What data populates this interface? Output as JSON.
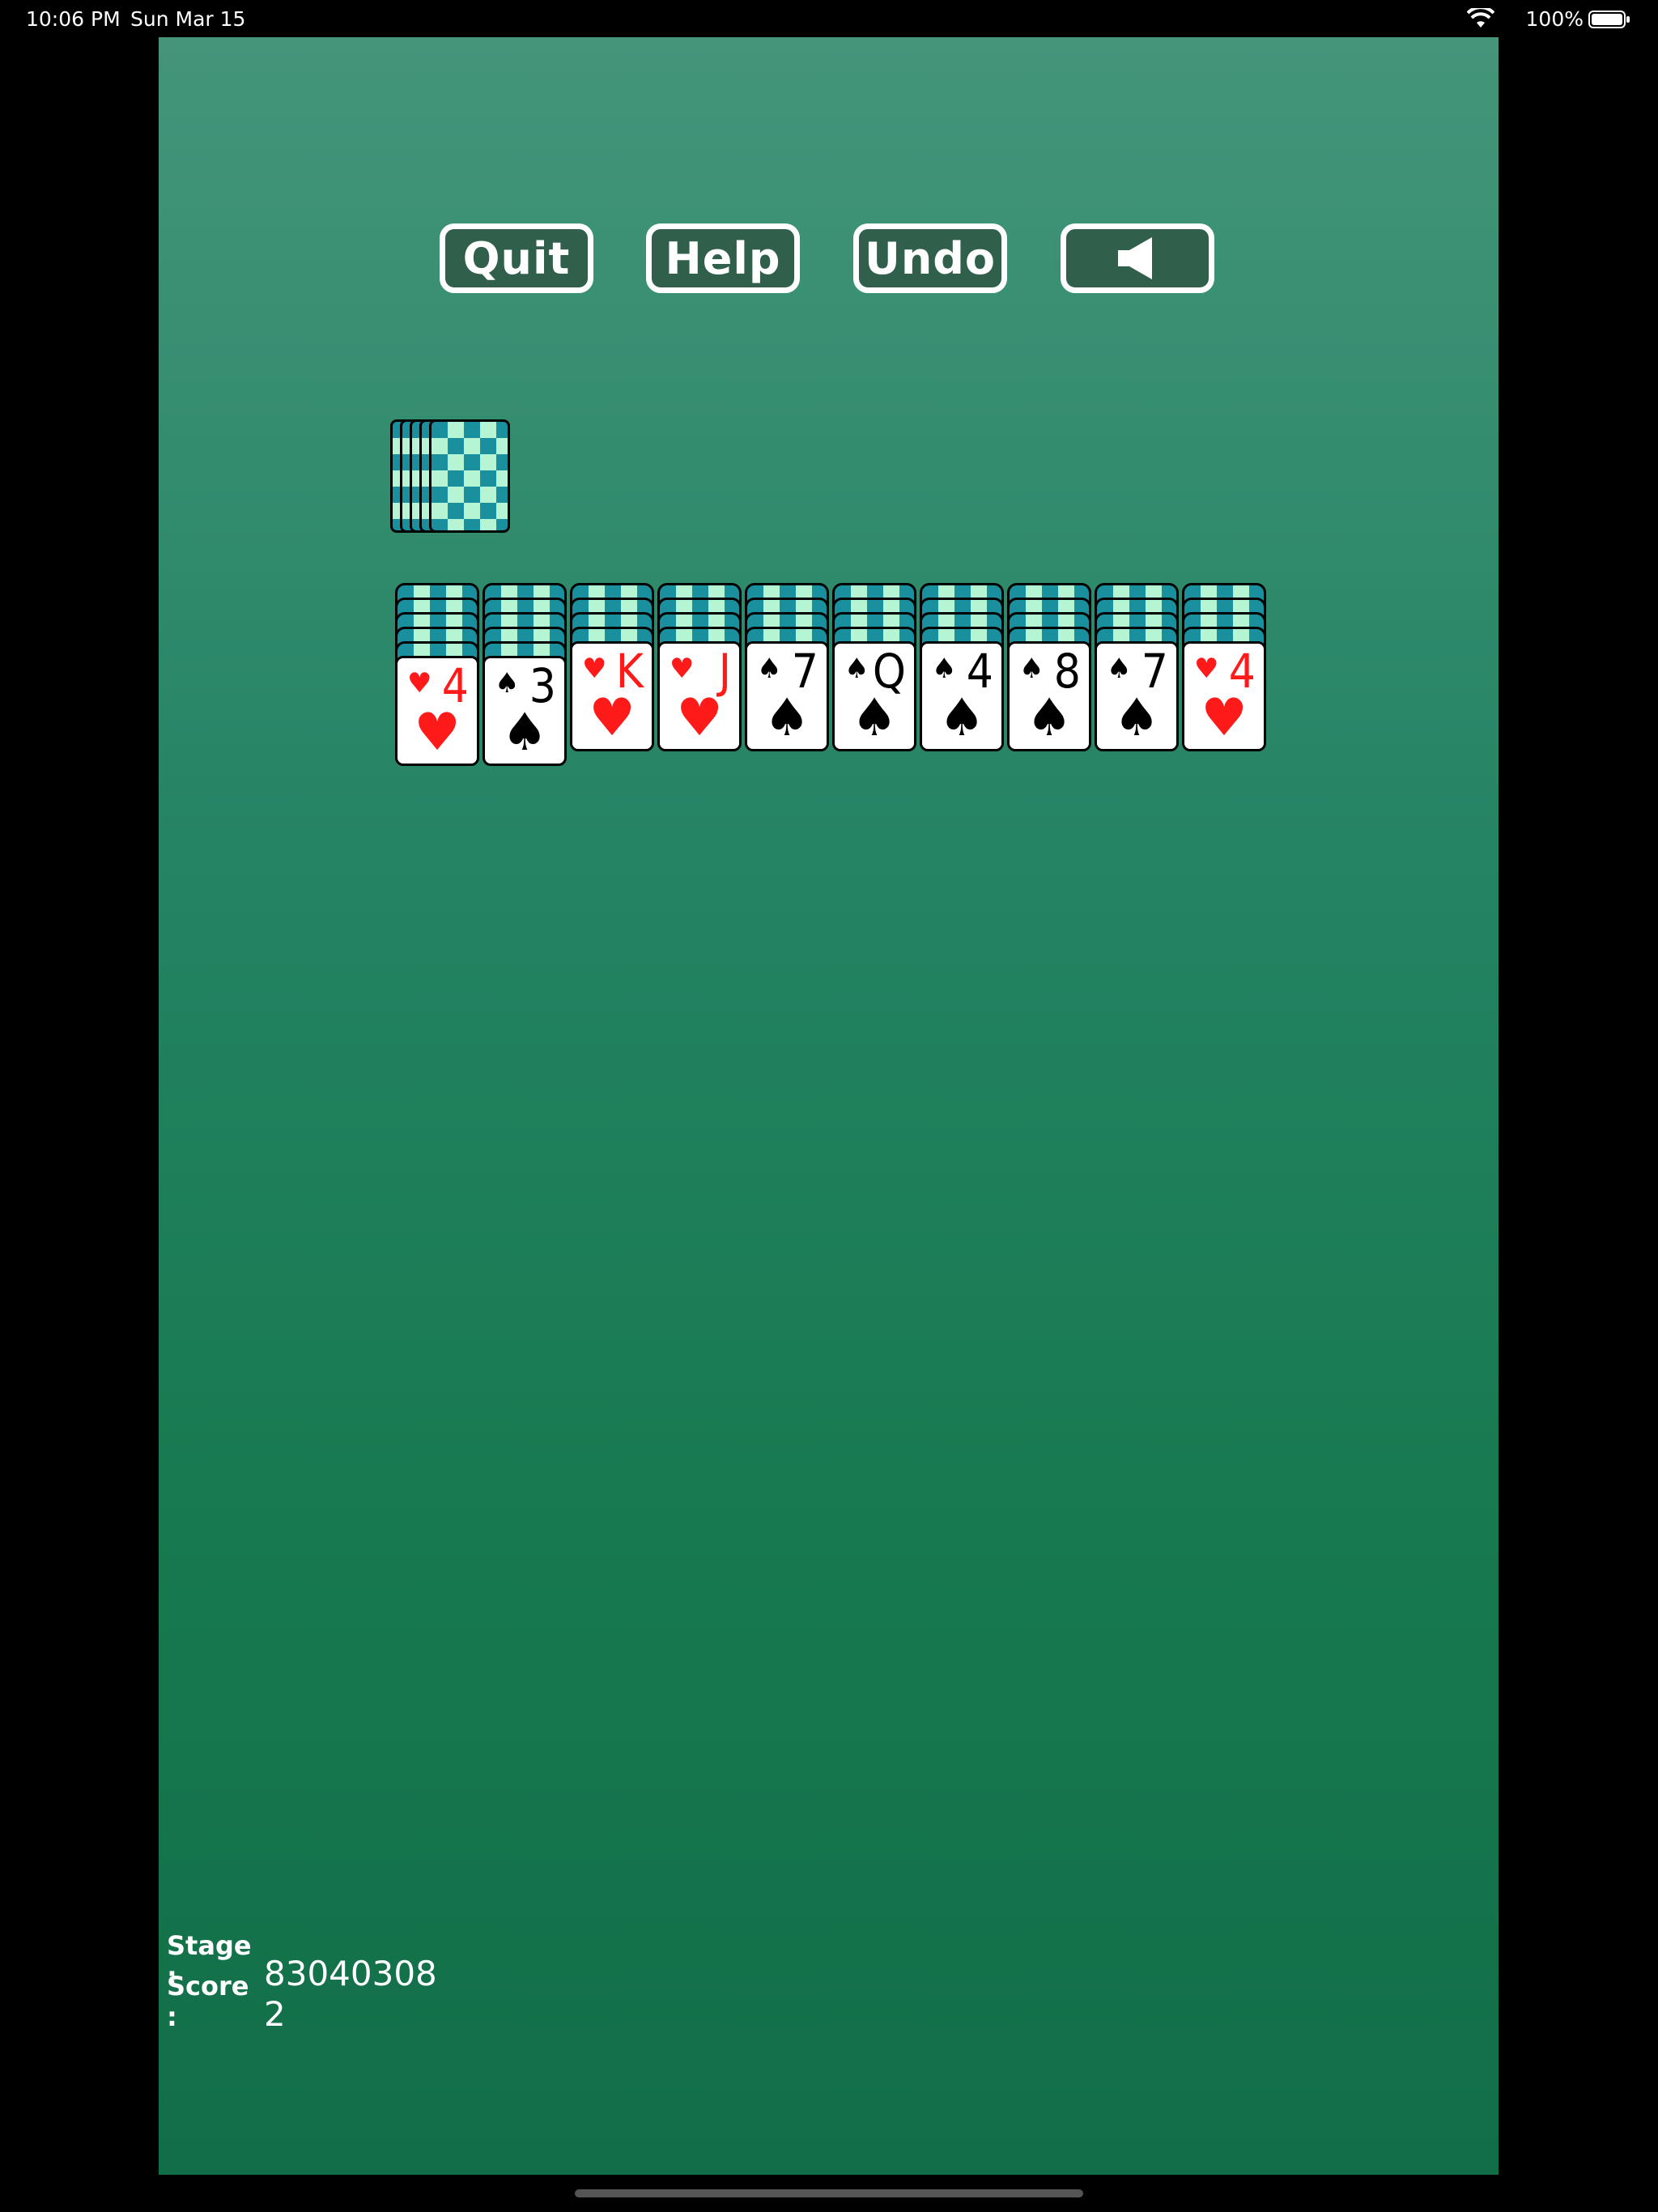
{
  "status_bar": {
    "time": "10:06 PM",
    "date": "Sun Mar 15",
    "battery_percent": "100%"
  },
  "buttons": {
    "quit": "Quit",
    "help": "Help",
    "undo": "Undo",
    "sound_icon": "speaker-icon"
  },
  "stock": {
    "card_back_count": 5
  },
  "tableau": [
    {
      "rank": "4",
      "suit": "♥",
      "color": "red",
      "hidden": 5
    },
    {
      "rank": "3",
      "suit": "♠",
      "color": "black",
      "hidden": 5
    },
    {
      "rank": "K",
      "suit": "♥",
      "color": "red",
      "hidden": 4
    },
    {
      "rank": "J",
      "suit": "♥",
      "color": "red",
      "hidden": 4
    },
    {
      "rank": "7",
      "suit": "♠",
      "color": "black",
      "hidden": 4
    },
    {
      "rank": "Q",
      "suit": "♠",
      "color": "black",
      "hidden": 4
    },
    {
      "rank": "4",
      "suit": "♠",
      "color": "black",
      "hidden": 4
    },
    {
      "rank": "8",
      "suit": "♠",
      "color": "black",
      "hidden": 4
    },
    {
      "rank": "7",
      "suit": "♠",
      "color": "black",
      "hidden": 4
    },
    {
      "rank": "4",
      "suit": "♥",
      "color": "red",
      "hidden": 4
    }
  ],
  "info": {
    "stage_label": "Stage :",
    "stage_value": "83040308",
    "score_label": "Score :",
    "score_value": "2"
  },
  "colors": {
    "felt": "#238363",
    "button_fill": "#30604c",
    "red_suit": "#ff1a1a",
    "card_back_light": "#b6f5d3",
    "card_back_dark": "#1a8f9d"
  }
}
